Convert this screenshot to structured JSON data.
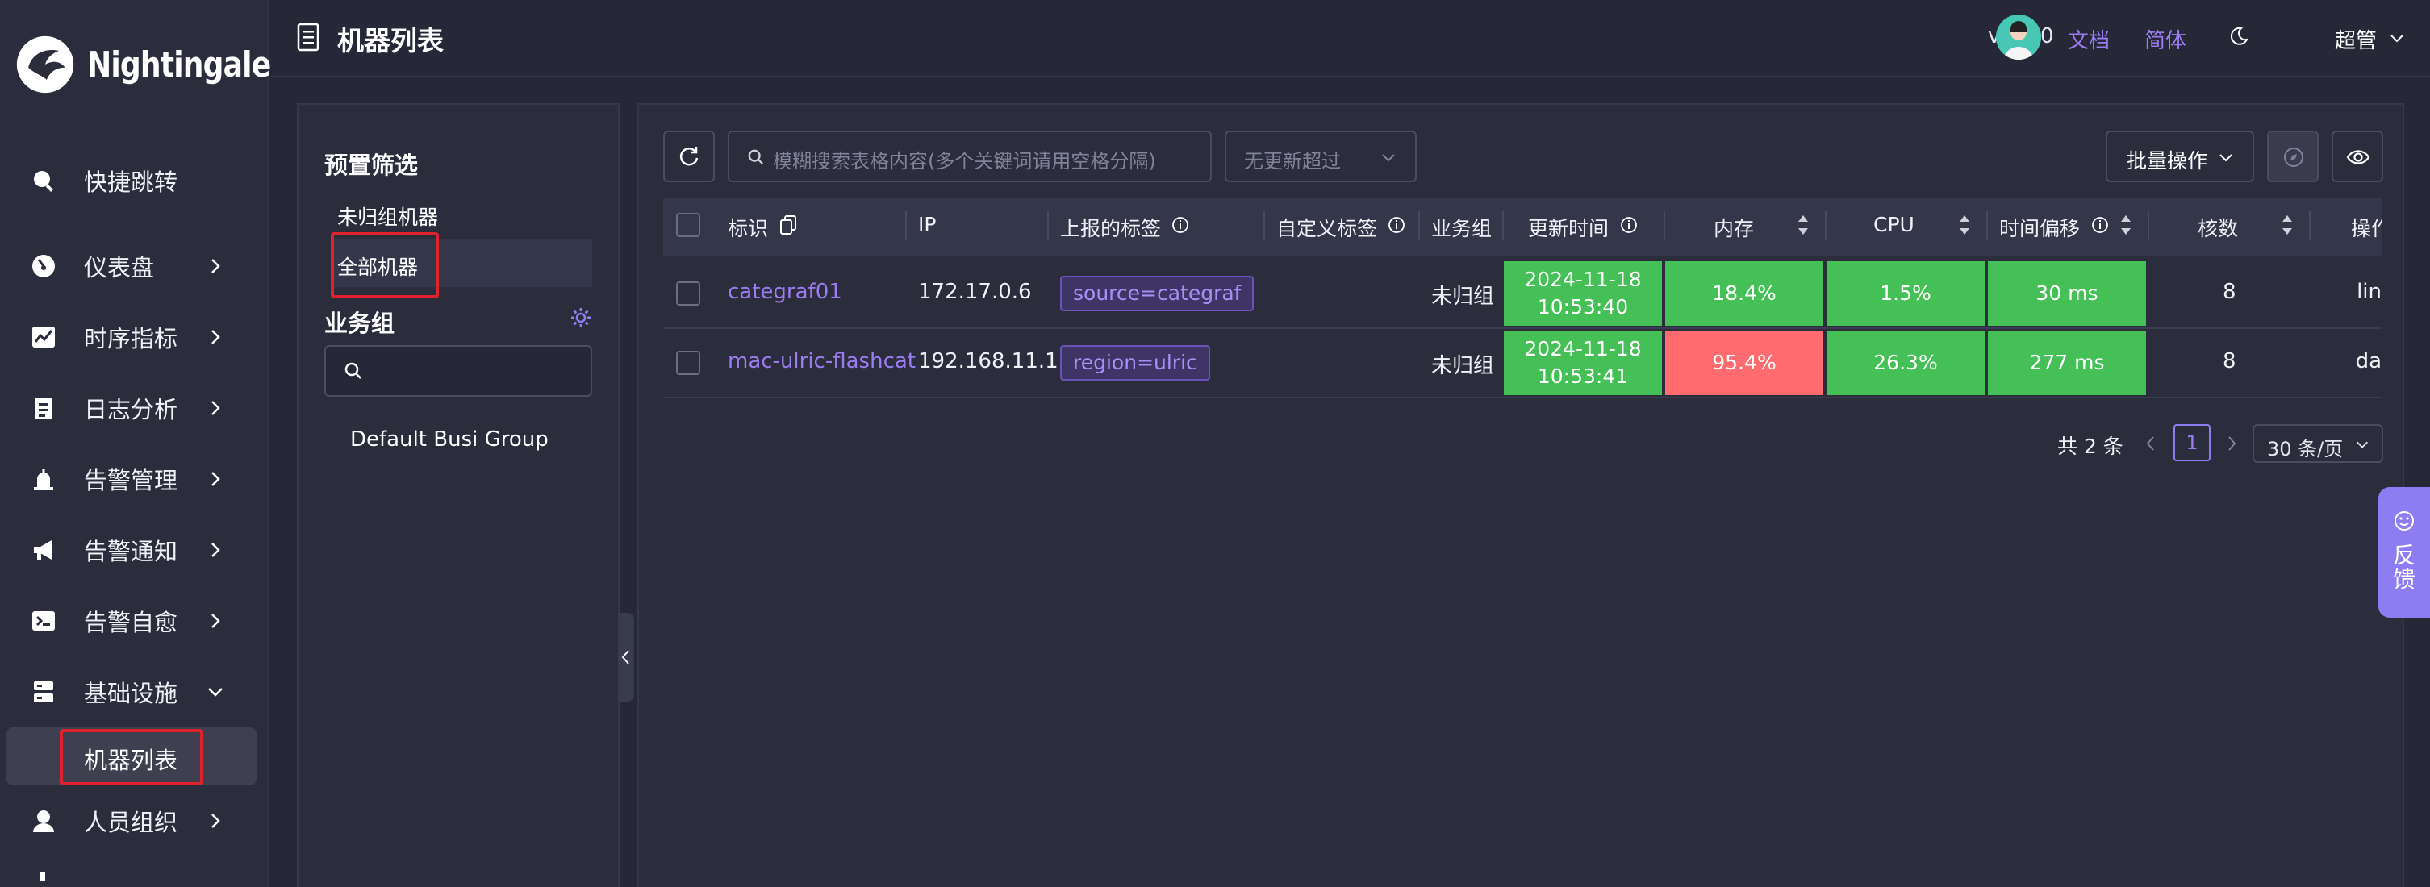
{
  "brand": {
    "name": "Nightingale"
  },
  "sidebar": {
    "items": [
      {
        "label": "快捷跳转",
        "icon": "search-icon"
      },
      {
        "label": "仪表盘",
        "icon": "dashboard-icon"
      },
      {
        "label": "时序指标",
        "icon": "chart-line-icon"
      },
      {
        "label": "日志分析",
        "icon": "log-icon"
      },
      {
        "label": "告警管理",
        "icon": "alarm-icon"
      },
      {
        "label": "告警通知",
        "icon": "megaphone-icon"
      },
      {
        "label": "告警自愈",
        "icon": "terminal-icon"
      },
      {
        "label": "基础设施",
        "icon": "server-icon"
      },
      {
        "label": "人员组织",
        "icon": "user-icon"
      }
    ],
    "active_sub": "机器列表"
  },
  "header": {
    "title": "机器列表",
    "version": "v7.7.0",
    "docs": "文档",
    "language": "简体",
    "user": "超管"
  },
  "filter": {
    "preset_title": "预置筛选",
    "preset_items": [
      "未归组机器",
      "全部机器"
    ],
    "busi_title": "业务组",
    "busi_groups": [
      "Default Busi Group"
    ]
  },
  "toolbar": {
    "search_placeholder": "模糊搜索表格内容(多个关键词请用空格分隔)",
    "no_update_placeholder": "无更新超过",
    "batch_label": "批量操作"
  },
  "table": {
    "columns": [
      "标识",
      "IP",
      "上报的标签",
      "自定义标签",
      "业务组",
      "更新时间",
      "内存",
      "CPU",
      "时间偏移",
      "核数",
      "操作"
    ],
    "rows": [
      {
        "ident": "categraf01",
        "ip": "172.17.0.6",
        "tag": "source=categraf",
        "group": "未归组",
        "update_date": "2024-11-18",
        "update_time": "10:53:40",
        "mem": "18.4%",
        "cpu": "1.5%",
        "offset": "30 ms",
        "cores": "8",
        "action": "lin",
        "mem_level": "ok"
      },
      {
        "ident": "mac-ulric-flashcat",
        "ip": "192.168.11.1",
        "tag": "region=ulric",
        "group": "未归组",
        "update_date": "2024-11-18",
        "update_time": "10:53:41",
        "mem": "95.4%",
        "cpu": "26.3%",
        "offset": "277 ms",
        "cores": "8",
        "action": "da",
        "mem_level": "high"
      }
    ]
  },
  "pagination": {
    "total": "共 2 条",
    "page": "1",
    "page_size": "30 条/页"
  },
  "feedback": {
    "label": "反馈"
  },
  "colors": {
    "accent": "#9b7cf0",
    "ok": "#44c056",
    "high": "#ff6b6e",
    "highlight": "#e0222c"
  }
}
